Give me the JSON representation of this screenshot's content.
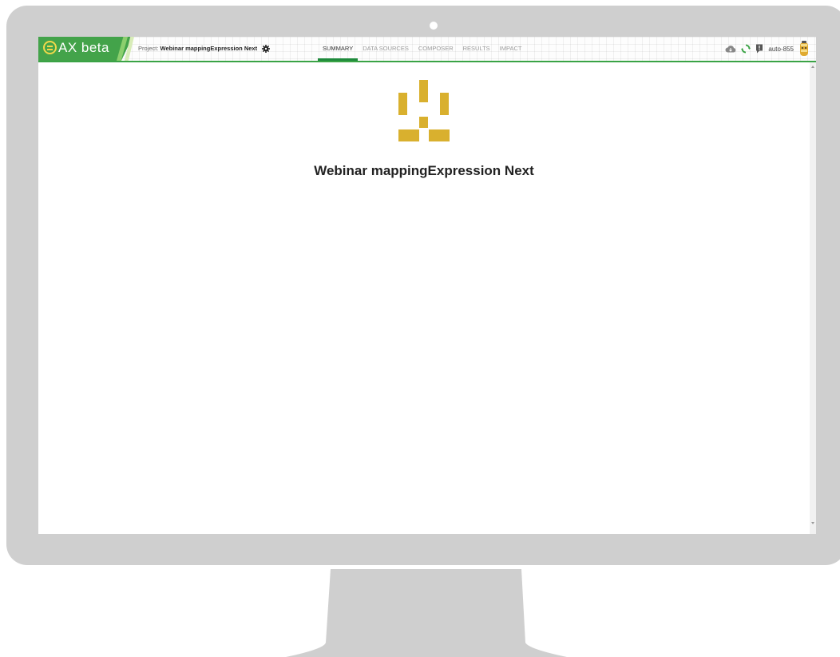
{
  "app": {
    "logo_text": "AX beta",
    "project_label": "Project:",
    "project_name": "Webinar mappingExpression Next"
  },
  "nav": {
    "tabs": [
      {
        "label": "SUMMARY",
        "active": true
      },
      {
        "label": "DATA SOURCES",
        "active": false
      },
      {
        "label": "COMPOSER",
        "active": false
      },
      {
        "label": "RESULTS",
        "active": false
      },
      {
        "label": "IMPACT",
        "active": false
      }
    ]
  },
  "user": {
    "name": "auto-855"
  },
  "main": {
    "title": "Webinar mappingExpression Next"
  },
  "icons": {
    "cloud": "cloud-icon",
    "refresh": "refresh-icon",
    "feedback": "feedback-icon",
    "avatar": "avatar"
  },
  "colors": {
    "brand_green": "#43a34a",
    "accent_gold": "#d9b02e",
    "active_tab": "#1f8a3c"
  }
}
